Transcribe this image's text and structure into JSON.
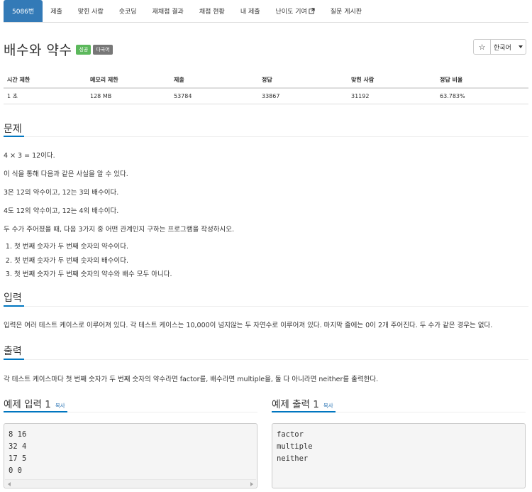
{
  "tabs": [
    {
      "label": "5086번",
      "active": true
    },
    {
      "label": "제출"
    },
    {
      "label": "맞힌 사람"
    },
    {
      "label": "숏코딩"
    },
    {
      "label": "재채점 결과"
    },
    {
      "label": "채점 현황"
    },
    {
      "label": "내 제출"
    },
    {
      "label": "난이도 기여"
    },
    {
      "label": "질문 게시판"
    }
  ],
  "problem": {
    "title": "배수와 약수",
    "badge_success": "성공",
    "badge_lang": "다국어",
    "language_select": "한국어",
    "star": "☆"
  },
  "stats": {
    "headers": [
      "시간 제한",
      "메모리 제한",
      "제출",
      "정답",
      "맞힌 사람",
      "정답 비율"
    ],
    "values": [
      "1 초",
      "128 MB",
      "53784",
      "33867",
      "31192",
      "63.783%"
    ]
  },
  "sections": {
    "problem_title": "문제",
    "problem_paragraphs": [
      "4 × 3 = 12이다.",
      "이 식을 통해 다음과 같은 사실을 알 수 있다.",
      "3은 12의 약수이고, 12는 3의 배수이다.",
      "4도 12의 약수이고, 12는 4의 배수이다.",
      "두 수가 주어졌을 때, 다음 3가지 중 어떤 관계인지 구하는 프로그램을 작성하시오."
    ],
    "conditions": [
      "첫 번째 숫자가 두 번째 숫자의 약수이다.",
      "첫 번째 숫자가 두 번째 숫자의 배수이다.",
      "첫 번째 숫자가 두 번째 숫자의 약수와 배수 모두 아니다."
    ],
    "input_title": "입력",
    "input_text": "입력은 여러 테스트 케이스로 이루어져 있다. 각 테스트 케이스는 10,000이 넘지않는 두 자연수로 이루어져 있다. 마지막 줄에는 0이 2개 주어진다. 두 수가 같은 경우는 없다.",
    "output_title": "출력",
    "output_text": "각 테스트 케이스마다 첫 번째 숫자가 두 번째 숫자의 약수라면 factor를, 배수라면 multiple을, 둘 다 아니라면 neither를 출력한다."
  },
  "samples": {
    "input_title": "예제 입력 1",
    "output_title": "예제 출력 1",
    "copy_label": "복사",
    "input_lines": [
      "8 16",
      "32 4",
      "17 5",
      "0 0"
    ],
    "output_lines": [
      "factor",
      "multiple",
      "neither"
    ]
  },
  "colors": {
    "active_tab": "#337ab7",
    "accent_underline": "#0076c0",
    "success_badge": "#5cb85c",
    "lang_badge": "#777777",
    "link": "#337ab7"
  }
}
